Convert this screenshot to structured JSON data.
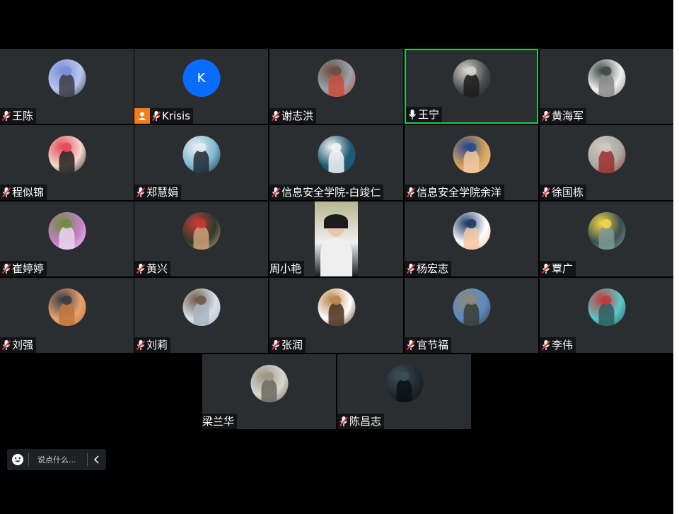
{
  "participants": [
    {
      "name": "王陈",
      "mic": "muted",
      "avatar": "photo-girl-sky",
      "colors": [
        "#b8c6f0",
        "#7d8fd6",
        "#3c3a45"
      ]
    },
    {
      "name": "Krisis",
      "mic": "muted",
      "host": true,
      "avatar": "letter",
      "letter": "K",
      "colors": [
        "#0a6cff"
      ]
    },
    {
      "name": "谢志洪",
      "mic": "muted",
      "avatar": "photo-group",
      "colors": [
        "#9aa3a8",
        "#6b4e44",
        "#c94c3c"
      ]
    },
    {
      "name": "王宁",
      "mic": "on",
      "active": true,
      "avatar": "photo-person-hat",
      "colors": [
        "#4a4f4f",
        "#d7d4cf",
        "#1b1b1b"
      ]
    },
    {
      "name": "黄海军",
      "mic": "muted",
      "avatar": "cartoon-hat",
      "colors": [
        "#f1f1f1",
        "#3d4a45",
        "#8a8a8a"
      ]
    },
    {
      "name": "程似锦",
      "mic": "muted",
      "avatar": "cartoon-girl",
      "colors": [
        "#f6d7cc",
        "#e34b5b",
        "#222222"
      ]
    },
    {
      "name": "郑慧娟",
      "mic": "muted",
      "avatar": "photo-seaside",
      "colors": [
        "#7fb7cf",
        "#e6eef2",
        "#1f2b35"
      ]
    },
    {
      "name": "信息安全学院-白竣仁",
      "mic": "muted",
      "avatar": "dancer-blue",
      "colors": [
        "#1e5a74",
        "#f4f4f4"
      ]
    },
    {
      "name": "信息安全学院余洋",
      "mic": "muted",
      "avatar": "cartoon-boy",
      "colors": [
        "#d9a35a",
        "#2a4a8c",
        "#f1c9a3"
      ]
    },
    {
      "name": "徐国栋",
      "mic": "muted",
      "avatar": "photo-portrait",
      "colors": [
        "#a9aaa5",
        "#cfc7bd",
        "#9c2f2f"
      ]
    },
    {
      "name": "崔婷婷",
      "mic": "muted",
      "avatar": "photo-flowers",
      "colors": [
        "#c77fc8",
        "#6e8d3f",
        "#e9d6ef"
      ]
    },
    {
      "name": "黄兴",
      "mic": "muted",
      "avatar": "photo-outdoor",
      "colors": [
        "#2f3a2d",
        "#c53a33",
        "#caa278"
      ]
    },
    {
      "name": "周小艳",
      "mic": "none",
      "avatar": "video",
      "colors": [
        "#b9b68d",
        "#efefef",
        "#1c1c1c"
      ]
    },
    {
      "name": "杨宏志",
      "mic": "muted",
      "avatar": "cartoon-chibi",
      "colors": [
        "#ffffff",
        "#1d3a66",
        "#f4c7a2"
      ]
    },
    {
      "name": "覃广",
      "mic": "muted",
      "avatar": "photo-blossom",
      "colors": [
        "#3a4f4f",
        "#f2d64a",
        "#7d9a98"
      ]
    },
    {
      "name": "刘强",
      "mic": "muted",
      "avatar": "photo-sunset",
      "colors": [
        "#e8a36e",
        "#3b3b48",
        "#c0763e"
      ]
    },
    {
      "name": "刘莉",
      "mic": "muted",
      "avatar": "photo-snow",
      "colors": [
        "#d9e1ea",
        "#6f5a4a",
        "#aab6c4"
      ]
    },
    {
      "name": "张润",
      "mic": "muted",
      "avatar": "teddy-bear",
      "colors": [
        "#ffffff",
        "#b9864e",
        "#4a2f1a"
      ]
    },
    {
      "name": "官节福",
      "mic": "muted",
      "avatar": "photo-statue",
      "colors": [
        "#5a8bc2",
        "#8a8a7a",
        "#3b3b33"
      ]
    },
    {
      "name": "李伟",
      "mic": "muted",
      "avatar": "pixel-art",
      "colors": [
        "#5ec6c8",
        "#c33c3c",
        "#2b5e5e"
      ]
    },
    {
      "name": "梁兰华",
      "mic": "none",
      "avatar": "photo-lion-statue",
      "colors": [
        "#d8d8d0",
        "#9e9686",
        "#6b6a60"
      ]
    },
    {
      "name": "陈昌志",
      "mic": "muted",
      "avatar": "photo-night",
      "colors": [
        "#1f2a30",
        "#3d4f55",
        "#0c1013"
      ]
    }
  ],
  "chat": {
    "placeholder": "说点什么...",
    "emoji_icon": "smiley-icon",
    "collapse_icon": "chevron-left-icon"
  },
  "colors": {
    "tile_bg": "#2b2e31",
    "active_border": "#1ecb5a",
    "host_badge": "#f57c16",
    "muted_mic": "#e0333a"
  }
}
